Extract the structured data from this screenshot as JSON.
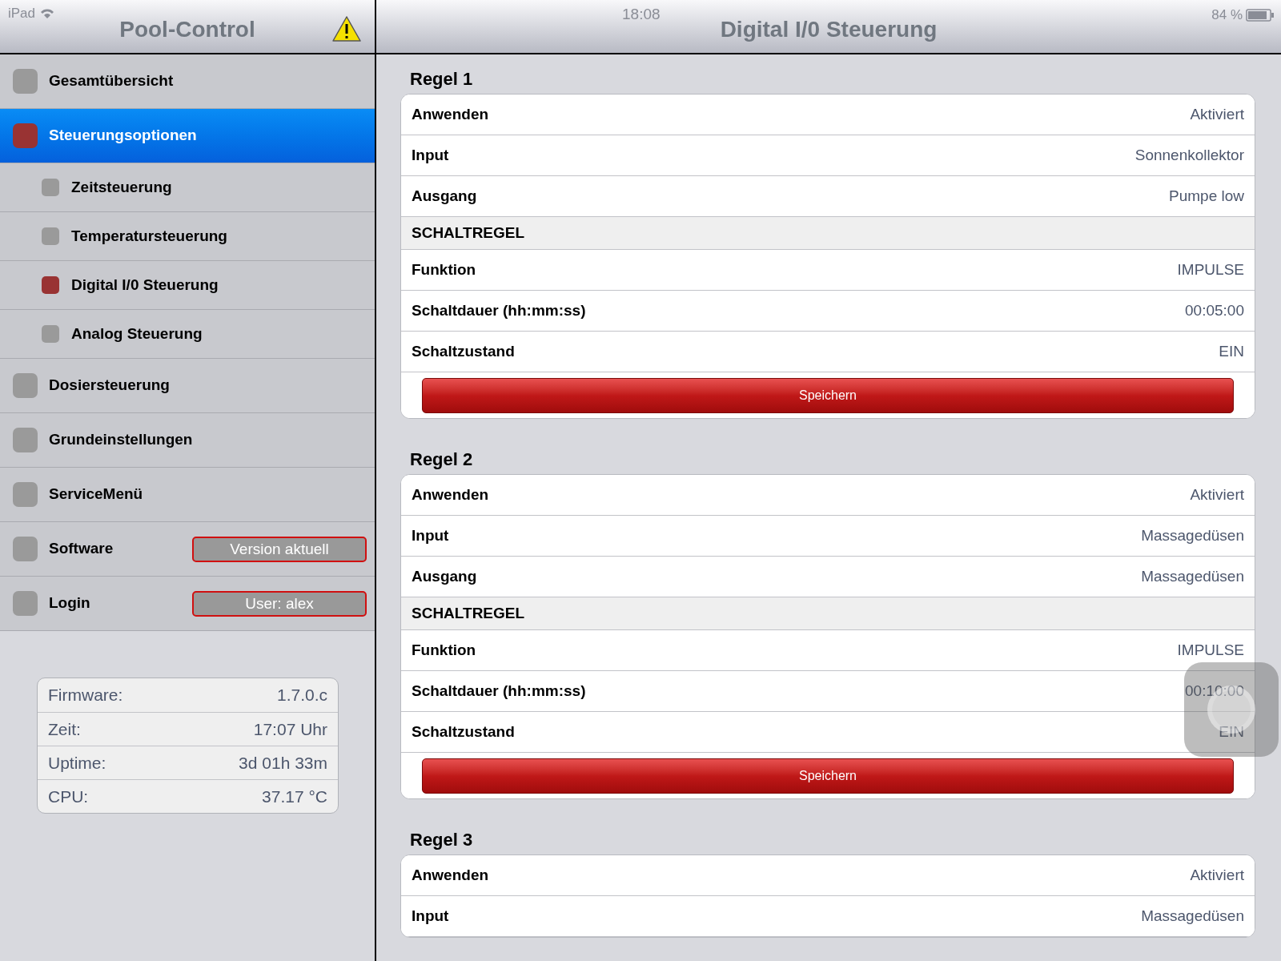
{
  "status_bar": {
    "device": "iPad",
    "time": "18:08",
    "battery": "84 %"
  },
  "sidebar": {
    "title": "Pool-Control",
    "items": [
      {
        "kind": "top",
        "label": "Gesamtübersicht",
        "selected": false,
        "color": "#9a9a9a"
      },
      {
        "kind": "top",
        "label": "Steuerungsoptionen",
        "selected": true,
        "color": "#993333"
      },
      {
        "kind": "sub",
        "label": "Zeitsteuerung",
        "selected": false,
        "color": "#9a9a9a"
      },
      {
        "kind": "sub",
        "label": "Temperatursteuerung",
        "selected": false,
        "color": "#9a9a9a"
      },
      {
        "kind": "sub",
        "label": "Digital I/0 Steuerung",
        "selected": false,
        "color": "#993333"
      },
      {
        "kind": "sub",
        "label": "Analog Steuerung",
        "selected": false,
        "color": "#9a9a9a"
      },
      {
        "kind": "top",
        "label": "Dosiersteuerung",
        "selected": false,
        "color": "#9a9a9a"
      },
      {
        "kind": "top",
        "label": "Grundeinstellungen",
        "selected": false,
        "color": "#9a9a9a"
      },
      {
        "kind": "top",
        "label": "ServiceMenü",
        "selected": false,
        "color": "#9a9a9a"
      },
      {
        "kind": "top",
        "label": "Software",
        "selected": false,
        "color": "#9a9a9a",
        "badge": "Version aktuell"
      },
      {
        "kind": "top",
        "label": "Login",
        "selected": false,
        "color": "#9a9a9a",
        "badge": "User: alex"
      }
    ],
    "info": [
      {
        "label": "Firmware:",
        "value": "1.7.0.c"
      },
      {
        "label": "Zeit:",
        "value": "17:07 Uhr"
      },
      {
        "label": "Uptime:",
        "value": "3d 01h 33m"
      },
      {
        "label": "CPU:",
        "value": "37.17 °C"
      }
    ]
  },
  "main": {
    "title": "Digital I/0 Steuerung",
    "rules": [
      {
        "title": "Regel 1",
        "rows": [
          {
            "kind": "row",
            "label": "Anwenden",
            "value": "Aktiviert"
          },
          {
            "kind": "row",
            "label": "Input",
            "value": "Sonnenkollektor"
          },
          {
            "kind": "row",
            "label": "Ausgang",
            "value": "Pumpe low"
          },
          {
            "kind": "section",
            "label": "SCHALTREGEL"
          },
          {
            "kind": "row",
            "label": "Funktion",
            "value": "IMPULSE"
          },
          {
            "kind": "row",
            "label": "Schaltdauer (hh:mm:ss)",
            "value": "00:05:00"
          },
          {
            "kind": "row",
            "label": "Schaltzustand",
            "value": "EIN"
          },
          {
            "kind": "button",
            "label": "Speichern"
          }
        ]
      },
      {
        "title": "Regel 2",
        "rows": [
          {
            "kind": "row",
            "label": "Anwenden",
            "value": "Aktiviert"
          },
          {
            "kind": "row",
            "label": "Input",
            "value": "Massagedüsen"
          },
          {
            "kind": "row",
            "label": "Ausgang",
            "value": "Massagedüsen"
          },
          {
            "kind": "section",
            "label": "SCHALTREGEL"
          },
          {
            "kind": "row",
            "label": "Funktion",
            "value": "IMPULSE"
          },
          {
            "kind": "row",
            "label": "Schaltdauer (hh:mm:ss)",
            "value": "00:10:00"
          },
          {
            "kind": "row",
            "label": "Schaltzustand",
            "value": "EIN"
          },
          {
            "kind": "button",
            "label": "Speichern"
          }
        ]
      },
      {
        "title": "Regel 3",
        "rows": [
          {
            "kind": "row",
            "label": "Anwenden",
            "value": "Aktiviert"
          },
          {
            "kind": "row",
            "label": "Input",
            "value": "Massagedüsen"
          }
        ]
      }
    ]
  }
}
